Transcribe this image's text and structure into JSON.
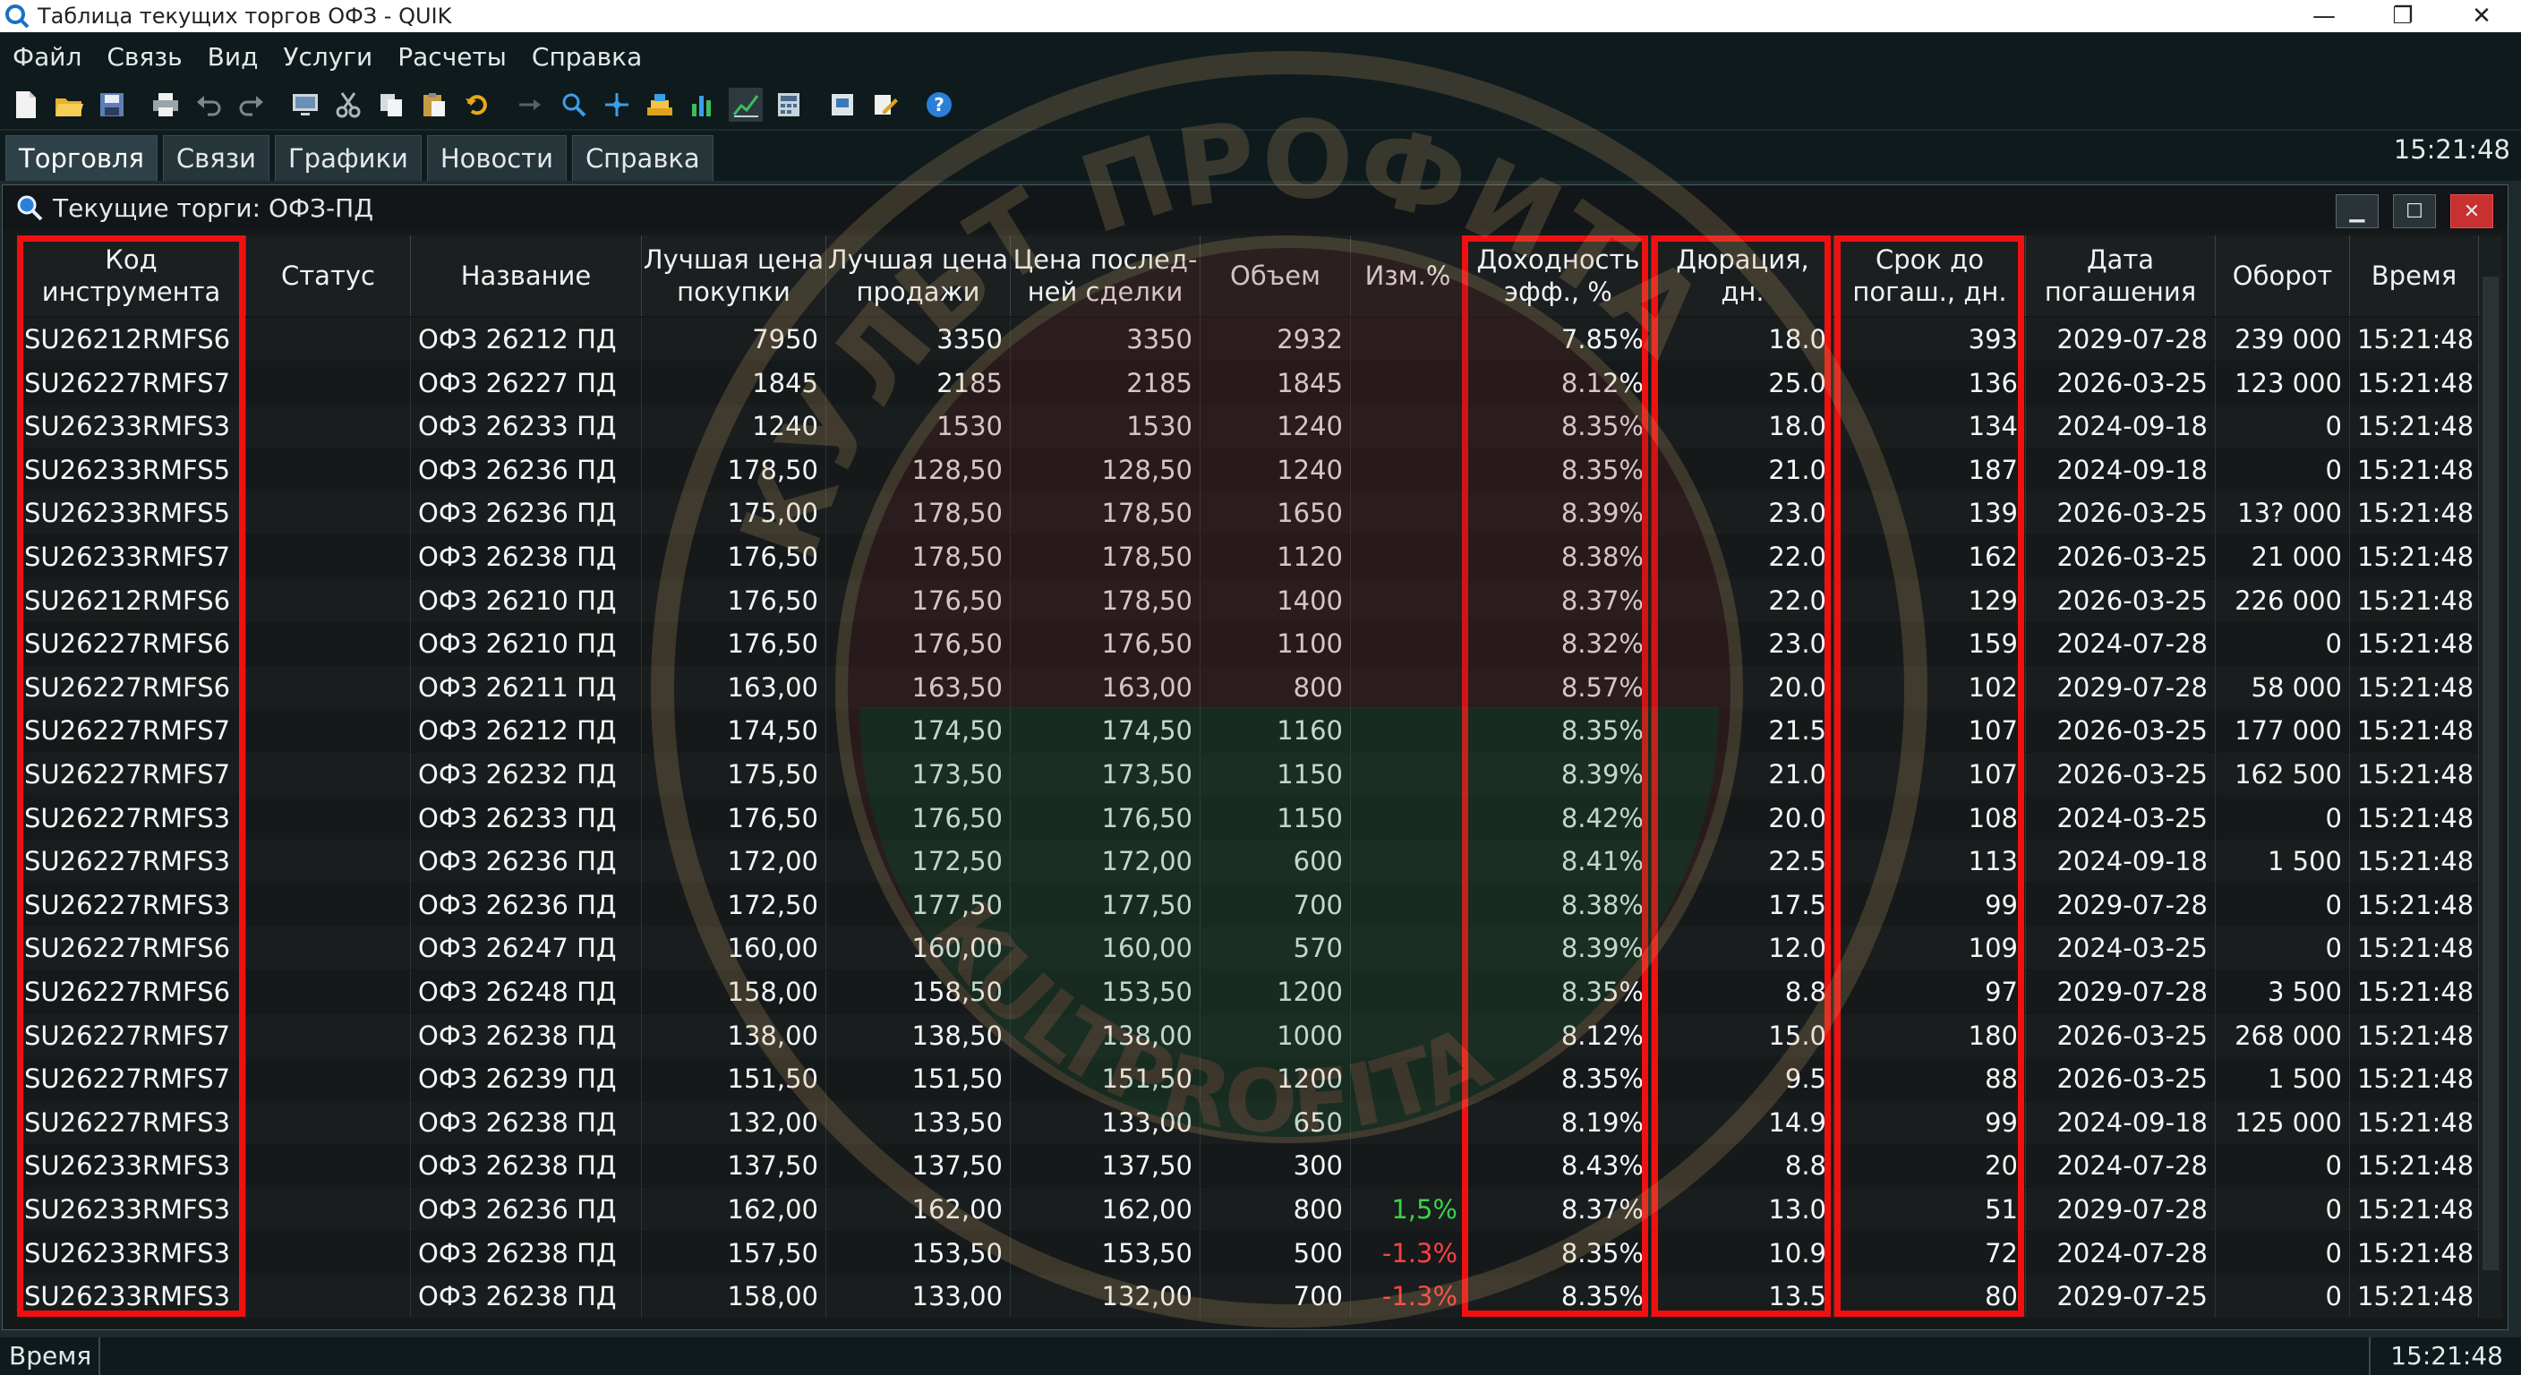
{
  "window": {
    "title": "Таблица текущих торгов ОФЗ - QUIK"
  },
  "menu": [
    "Файл",
    "Связь",
    "Вид",
    "Услуги",
    "Расчеты",
    "Справка"
  ],
  "toolbar_icons": [
    "new-file-icon",
    "open-folder-icon",
    "save-icon",
    "print-icon",
    "undo-icon",
    "redo-icon",
    "monitor-icon",
    "cut-icon",
    "copy-icon",
    "paste-icon",
    "refresh-icon",
    "arrow-icon",
    "zoom-icon",
    "crosshair-icon",
    "stack-icon",
    "bar-chart-icon",
    "line-chart-icon",
    "calculator-icon",
    "portfolio-icon",
    "edit-icon",
    "help-icon"
  ],
  "tabs": [
    "Торговля",
    "Связи",
    "Графики",
    "Новости",
    "Справка"
  ],
  "clock": "15:21:48",
  "subwindow": {
    "title": "Текущие торги: ОФЗ-ПД"
  },
  "columns": [
    "Код\nинструмента",
    "Статус",
    "Название",
    "Лучшая цена\nпокупки",
    "Лучшая цена\nпродажи",
    "Цена послед-\nней сделки",
    "Объем",
    "Изм.%",
    "Доходность\nэфф., %",
    "Дюрация, дн.",
    "Срок до\nпогаш., дн.",
    "Дата\nпогашения",
    "Оборот",
    "Время"
  ],
  "rows": [
    [
      "SU26212RMFS6",
      "",
      "ОФЗ 26212 ПД",
      "7950",
      "3350",
      "3350",
      "2932",
      "",
      "7.85%",
      "18.0",
      "393",
      "2029-07-28",
      "239 000",
      "15:21:48"
    ],
    [
      "SU26227RMFS7",
      "",
      "ОФЗ 26227 ПД",
      "1845",
      "2185",
      "2185",
      "1845",
      "",
      "8.12%",
      "25.0",
      "136",
      "2026-03-25",
      "123 000",
      "15:21:48"
    ],
    [
      "SU26233RMFS3",
      "",
      "ОФЗ 26233 ПД",
      "1240",
      "1530",
      "1530",
      "1240",
      "",
      "8.35%",
      "18.0",
      "134",
      "2024-09-18",
      "0",
      "15:21:48"
    ],
    [
      "SU26233RMFS5",
      "",
      "ОФЗ 26236 ПД",
      "178,50",
      "128,50",
      "128,50",
      "1240",
      "",
      "8.35%",
      "21.0",
      "187",
      "2024-09-18",
      "0",
      "15:21:48"
    ],
    [
      "SU26233RMFS5",
      "",
      "ОФЗ 26236 ПД",
      "175,00",
      "178,50",
      "178,50",
      "1650",
      "",
      "8.39%",
      "23.0",
      "139",
      "2026-03-25",
      "13? 000",
      "15:21:48"
    ],
    [
      "SU26233RMFS7",
      "",
      "ОФЗ 26238 ПД",
      "176,50",
      "178,50",
      "178,50",
      "1120",
      "",
      "8.38%",
      "22.0",
      "162",
      "2026-03-25",
      "21 000",
      "15:21:48"
    ],
    [
      "SU26212RMFS6",
      "",
      "ОФЗ 26210 ПД",
      "176,50",
      "176,50",
      "178,50",
      "1400",
      "",
      "8.37%",
      "22.0",
      "129",
      "2026-03-25",
      "226 000",
      "15:21:48"
    ],
    [
      "SU26227RMFS6",
      "",
      "ОФЗ 26210 ПД",
      "176,50",
      "176,50",
      "176,50",
      "1100",
      "",
      "8.32%",
      "23.0",
      "159",
      "2024-07-28",
      "0",
      "15:21:48"
    ],
    [
      "SU26227RMFS6",
      "",
      "ОФЗ 26211 ПД",
      "163,00",
      "163,50",
      "163,00",
      "800",
      "",
      "8.57%",
      "20.0",
      "102",
      "2029-07-28",
      "58 000",
      "15:21:48"
    ],
    [
      "SU26227RMFS7",
      "",
      "ОФЗ 26212 ПД",
      "174,50",
      "174,50",
      "174,50",
      "1160",
      "",
      "8.35%",
      "21.5",
      "107",
      "2026-03-25",
      "177 000",
      "15:21:48"
    ],
    [
      "SU26227RMFS7",
      "",
      "ОФЗ 26232 ПД",
      "175,50",
      "173,50",
      "173,50",
      "1150",
      "",
      "8.39%",
      "21.0",
      "107",
      "2026-03-25",
      "162 500",
      "15:21:48"
    ],
    [
      "SU26227RMFS3",
      "",
      "ОФЗ 26233 ПД",
      "176,50",
      "176,50",
      "176,50",
      "1150",
      "",
      "8.42%",
      "20.0",
      "108",
      "2024-03-25",
      "0",
      "15:21:48"
    ],
    [
      "SU26227RMFS3",
      "",
      "ОФЗ 26236 ПД",
      "172,00",
      "172,50",
      "172,00",
      "600",
      "",
      "8.41%",
      "22.5",
      "113",
      "2024-09-18",
      "1 500",
      "15:21:48"
    ],
    [
      "SU26227RMFS3",
      "",
      "ОФЗ 26236 ПД",
      "172,50",
      "177,50",
      "177,50",
      "700",
      "",
      "8.38%",
      "17.5",
      "99",
      "2029-07-28",
      "0",
      "15:21:48"
    ],
    [
      "SU26227RMFS6",
      "",
      "ОФЗ 26247 ПД",
      "160,00",
      "160,00",
      "160,00",
      "570",
      "",
      "8.39%",
      "12.0",
      "109",
      "2024-03-25",
      "0",
      "15:21:48"
    ],
    [
      "SU26227RMFS6",
      "",
      "ОФЗ 26248 ПД",
      "158,00",
      "158,50",
      "153,50",
      "1200",
      "",
      "8.35%",
      "8.8",
      "97",
      "2029-07-28",
      "3 500",
      "15:21:48"
    ],
    [
      "SU26227RMFS7",
      "",
      "ОФЗ 26238 ПД",
      "138,00",
      "138,50",
      "138,00",
      "1000",
      "",
      "8.12%",
      "15.0",
      "180",
      "2026-03-25",
      "268 000",
      "15:21:48"
    ],
    [
      "SU26227RMFS7",
      "",
      "ОФЗ 26239 ПД",
      "151,50",
      "151,50",
      "151,50",
      "1200",
      "",
      "8.35%",
      "9.5",
      "88",
      "2026-03-25",
      "1 500",
      "15:21:48"
    ],
    [
      "SU26227RMFS3",
      "",
      "ОФЗ 26238 ПД",
      "132,00",
      "133,50",
      "133,00",
      "650",
      "",
      "8.19%",
      "14.9",
      "99",
      "2024-09-18",
      "125 000",
      "15:21:48"
    ],
    [
      "SU26233RMFS3",
      "",
      "ОФЗ 26238 ПД",
      "137,50",
      "137,50",
      "137,50",
      "300",
      "",
      "8.43%",
      "8.8",
      "20",
      "2024-07-28",
      "0",
      "15:21:48"
    ],
    [
      "SU26233RMFS3",
      "",
      "ОФЗ 26236 ПД",
      "162,00",
      "162,00",
      "162,00",
      "800",
      "1,5%",
      "8.37%",
      "13.0",
      "51",
      "2029-07-28",
      "0",
      "15:21:48"
    ],
    [
      "SU26233RMFS3",
      "",
      "ОФЗ 26238 ПД",
      "157,50",
      "153,50",
      "153,50",
      "500",
      "-1.3%",
      "8.35%",
      "10.9",
      "72",
      "2024-07-28",
      "0",
      "15:21:48"
    ],
    [
      "SU26233RMFS3",
      "",
      "ОФЗ 26238 ПД",
      "158,00",
      "133,00",
      "132,00",
      "700",
      "-1.3%",
      "8.35%",
      "13.5",
      "80",
      "2029-07-25",
      "0",
      "15:21:48"
    ]
  ],
  "change_colors": {
    "positive": "#3ad24a",
    "negative": "#ff4040"
  },
  "highlight_color": "#f01010",
  "watermark": {
    "top_text": "КУЛЬТ ПРОФИТА",
    "bottom_text": "KULTPROFITA"
  },
  "statusbar": {
    "label": "Время",
    "clock": "15:21:48"
  }
}
